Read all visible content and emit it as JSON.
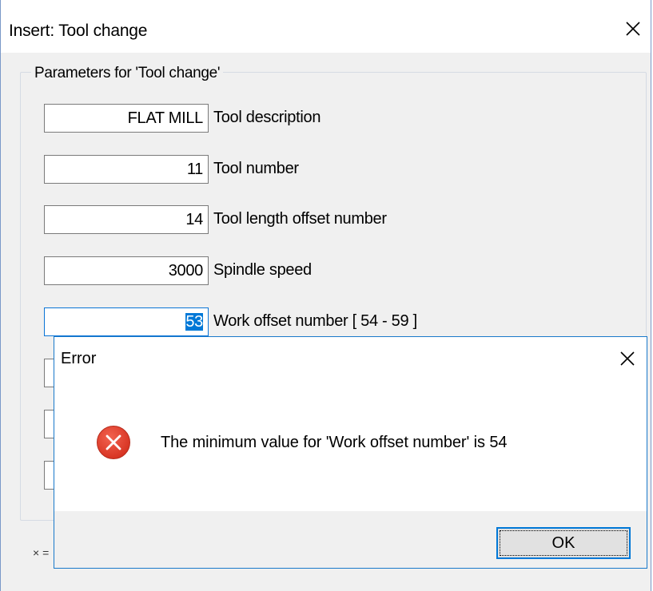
{
  "main_dialog": {
    "title": "Insert: Tool change",
    "close_icon": "close-icon",
    "group_label": "Parameters for 'Tool change'",
    "params": [
      {
        "value": "FLAT MILL",
        "label": "Tool description"
      },
      {
        "value": "11",
        "label": "Tool number"
      },
      {
        "value": "14",
        "label": "Tool length offset number"
      },
      {
        "value": "3000",
        "label": "Spindle speed"
      },
      {
        "value": "53",
        "label": "Work offset number  [ 54 - 59 ]"
      }
    ],
    "footnote": "× ="
  },
  "error_dialog": {
    "title": "Error",
    "close_icon": "close-icon",
    "icon": "error-icon",
    "message": "The minimum value for 'Work offset number' is 54",
    "ok_label": "OK"
  },
  "colors": {
    "accent": "#0078d7",
    "error_icon": "#e81123",
    "dialog_bg": "#f0f0f0"
  }
}
